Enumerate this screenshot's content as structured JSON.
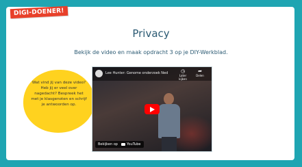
{
  "badge": {
    "label": "DIGI-DOENER!"
  },
  "header": {
    "title": "Privacy",
    "subtitle": "Bekijk de video en maak opdracht 3 op je DIY-Werkblad."
  },
  "bubble": {
    "text": "Wat vind jij van deze video? Heb jij er veel over nagedacht? Bespreek het met je klasgenoten en schrijf je antwoorden op."
  },
  "video": {
    "title": "Lee Hunter: Genome onderzoek Ned",
    "watch_later_label": "Later kijken",
    "share_label": "Delen",
    "watch_on_label": "Bekijken op",
    "platform_label": "YouTube",
    "colors": {
      "play": "#ff0000"
    }
  },
  "colors": {
    "frame": "#1fa5b2",
    "badge": "#e8402a",
    "bubble": "#ffd21f",
    "title": "#2b5a73"
  }
}
